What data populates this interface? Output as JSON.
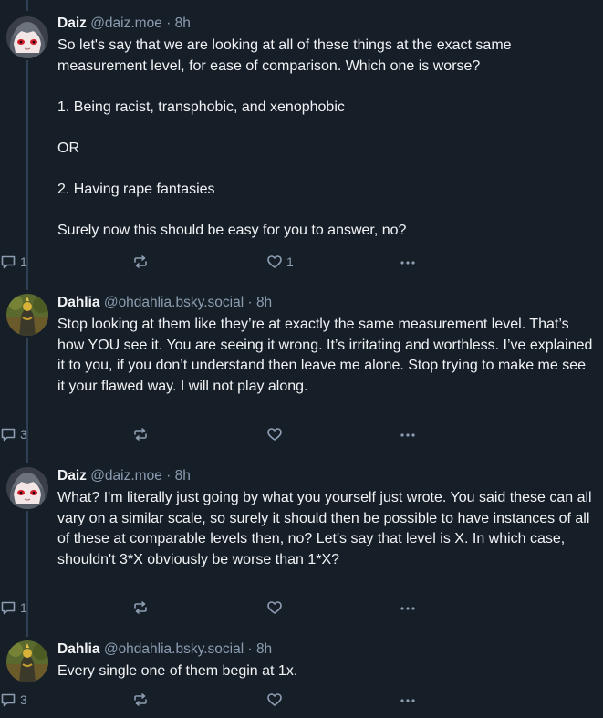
{
  "posts": [
    {
      "author": "daiz",
      "display_name": "Daiz",
      "handle": "@daiz.moe",
      "separator": "·",
      "time": "8h",
      "paragraphs": [
        "So let's say that we are looking at all of these things at the exact same measurement level, for ease of comparison. Which one is worse?",
        "1. Being racist, transphobic, and xenophobic",
        "OR",
        "2. Having rape fantasies",
        "Surely now this should be easy for you to answer, no?"
      ],
      "reply_count": "1",
      "repost_count": "",
      "like_count": "1"
    },
    {
      "author": "dahlia",
      "display_name": "Dahlia",
      "handle": "@ohdahlia.bsky.social",
      "separator": "·",
      "time": "8h",
      "paragraphs": [
        "Stop looking at them like they’re at exactly the same measurement level. That’s how YOU see it. You are seeing it wrong. It’s irritating and worthless. I’ve explained it to you, if you don’t understand then leave me alone. Stop trying to make me see it your flawed way. I will not play along."
      ],
      "reply_count": "3",
      "repost_count": "",
      "like_count": ""
    },
    {
      "author": "daiz",
      "display_name": "Daiz",
      "handle": "@daiz.moe",
      "separator": "·",
      "time": "8h",
      "paragraphs": [
        "What? I'm literally just going by what you yourself just wrote. You said these can all vary on a similar scale, so surely it should then be possible to have instances of all of these at comparable levels then, no? Let's say that level is X. In which case, shouldn't 3*X obviously be worse than 1*X?"
      ],
      "reply_count": "1",
      "repost_count": "",
      "like_count": ""
    },
    {
      "author": "dahlia",
      "display_name": "Dahlia",
      "handle": "@ohdahlia.bsky.social",
      "separator": "·",
      "time": "8h",
      "paragraphs": [
        "Every single one of them begin at 1x."
      ],
      "reply_count": "3",
      "repost_count": "",
      "like_count": ""
    }
  ],
  "icons": {
    "reply": "speech-bubble-icon",
    "repost": "repost-arrows-icon",
    "like": "heart-icon",
    "more": "more-dots-icon"
  },
  "colors": {
    "background": "#161e27",
    "text": "#f1f3f5",
    "muted": "#8c9db1",
    "thread_line": "#2e4052"
  }
}
